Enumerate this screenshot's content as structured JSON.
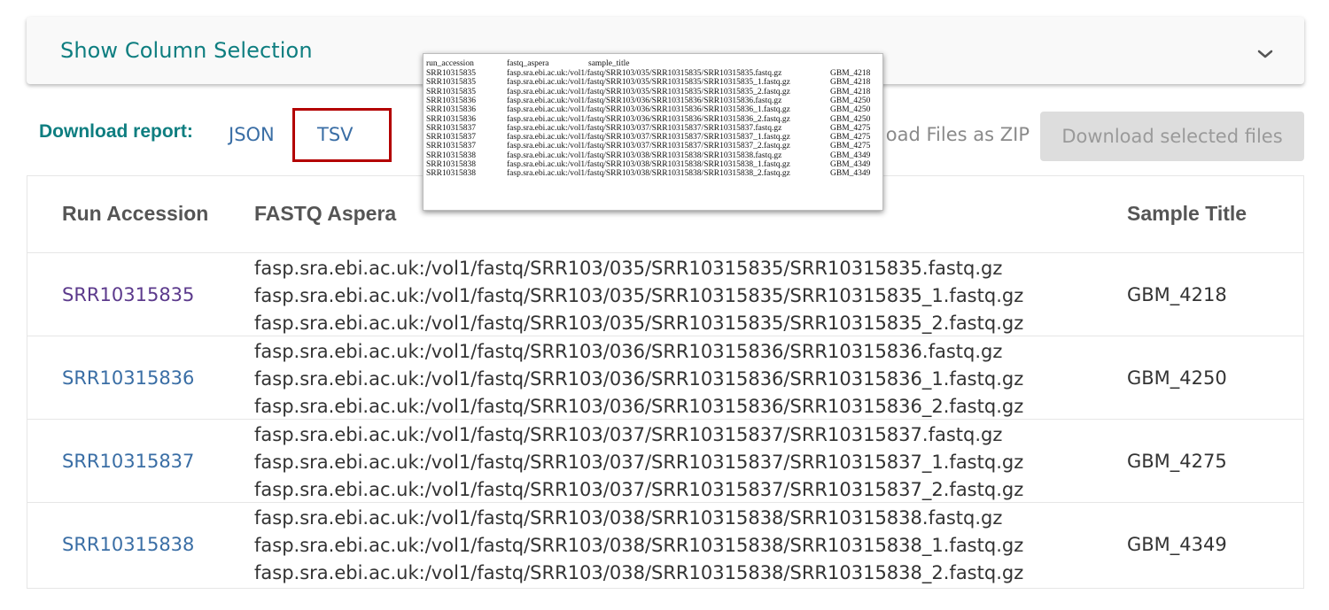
{
  "column_selection": {
    "title": "Show Column Selection",
    "toggle_icon": "chevron-down-icon"
  },
  "download": {
    "label": "Download report:",
    "json": "JSON",
    "tsv": "TSV",
    "zip_partial": "oad Files as ZIP",
    "selected_button": "Download selected files"
  },
  "table": {
    "headers": [
      "Run Accession",
      "FASTQ Aspera",
      "Sample Title"
    ],
    "rows": [
      {
        "accession": "SRR10315835",
        "paths": [
          "fasp.sra.ebi.ac.uk:/vol1/fastq/SRR103/035/SRR10315835/SRR10315835.fastq.gz",
          "fasp.sra.ebi.ac.uk:/vol1/fastq/SRR103/035/SRR10315835/SRR10315835_1.fastq.gz",
          "fasp.sra.ebi.ac.uk:/vol1/fastq/SRR103/035/SRR10315835/SRR10315835_2.fastq.gz"
        ],
        "sample": "GBM_4218"
      },
      {
        "accession": "SRR10315836",
        "paths": [
          "fasp.sra.ebi.ac.uk:/vol1/fastq/SRR103/036/SRR10315836/SRR10315836.fastq.gz",
          "fasp.sra.ebi.ac.uk:/vol1/fastq/SRR103/036/SRR10315836/SRR10315836_1.fastq.gz",
          "fasp.sra.ebi.ac.uk:/vol1/fastq/SRR103/036/SRR10315836/SRR10315836_2.fastq.gz"
        ],
        "sample": "GBM_4250"
      },
      {
        "accession": "SRR10315837",
        "paths": [
          "fasp.sra.ebi.ac.uk:/vol1/fastq/SRR103/037/SRR10315837/SRR10315837.fastq.gz",
          "fasp.sra.ebi.ac.uk:/vol1/fastq/SRR103/037/SRR10315837/SRR10315837_1.fastq.gz",
          "fasp.sra.ebi.ac.uk:/vol1/fastq/SRR103/037/SRR10315837/SRR10315837_2.fastq.gz"
        ],
        "sample": "GBM_4275"
      },
      {
        "accession": "SRR10315838",
        "paths": [
          "fasp.sra.ebi.ac.uk:/vol1/fastq/SRR103/038/SRR10315838/SRR10315838.fastq.gz",
          "fasp.sra.ebi.ac.uk:/vol1/fastq/SRR103/038/SRR10315838/SRR10315838_1.fastq.gz",
          "fasp.sra.ebi.ac.uk:/vol1/fastq/SRR103/038/SRR10315838/SRR10315838_2.fastq.gz"
        ],
        "sample": "GBM_4349"
      }
    ]
  },
  "tsv_preview": {
    "headers": [
      "run_accession",
      "fastq_aspera",
      "sample_title"
    ],
    "rows": [
      [
        "SRR10315835",
        "fasp.sra.ebi.ac.uk:/vol1/fastq/SRR103/035/SRR10315835/SRR10315835.fastq.gz",
        "GBM_4218"
      ],
      [
        "SRR10315835",
        "fasp.sra.ebi.ac.uk:/vol1/fastq/SRR103/035/SRR10315835/SRR10315835_1.fastq.gz",
        "GBM_4218"
      ],
      [
        "SRR10315835",
        "fasp.sra.ebi.ac.uk:/vol1/fastq/SRR103/035/SRR10315835/SRR10315835_2.fastq.gz",
        "GBM_4218"
      ],
      [
        "SRR10315836",
        "fasp.sra.ebi.ac.uk:/vol1/fastq/SRR103/036/SRR10315836/SRR10315836.fastq.gz",
        "GBM_4250"
      ],
      [
        "SRR10315836",
        "fasp.sra.ebi.ac.uk:/vol1/fastq/SRR103/036/SRR10315836/SRR10315836_1.fastq.gz",
        "GBM_4250"
      ],
      [
        "SRR10315836",
        "fasp.sra.ebi.ac.uk:/vol1/fastq/SRR103/036/SRR10315836/SRR10315836_2.fastq.gz",
        "GBM_4250"
      ],
      [
        "SRR10315837",
        "fasp.sra.ebi.ac.uk:/vol1/fastq/SRR103/037/SRR10315837/SRR10315837.fastq.gz",
        "GBM_4275"
      ],
      [
        "SRR10315837",
        "fasp.sra.ebi.ac.uk:/vol1/fastq/SRR103/037/SRR10315837/SRR10315837_1.fastq.gz",
        "GBM_4275"
      ],
      [
        "SRR10315837",
        "fasp.sra.ebi.ac.uk:/vol1/fastq/SRR103/037/SRR10315837/SRR10315837_2.fastq.gz",
        "GBM_4275"
      ],
      [
        "SRR10315838",
        "fasp.sra.ebi.ac.uk:/vol1/fastq/SRR103/038/SRR10315838/SRR10315838.fastq.gz",
        "GBM_4349"
      ],
      [
        "SRR10315838",
        "fasp.sra.ebi.ac.uk:/vol1/fastq/SRR103/038/SRR10315838/SRR10315838_1.fastq.gz",
        "GBM_4349"
      ],
      [
        "SRR10315838",
        "fasp.sra.ebi.ac.uk:/vol1/fastq/SRR103/038/SRR10315838/SRR10315838_2.fastq.gz",
        "GBM_4349"
      ]
    ]
  },
  "colors": {
    "accent": "#0e7e80",
    "link": "#3a6ea5",
    "visited_link": "#5c3a8c",
    "highlight_box": "#b30000"
  }
}
